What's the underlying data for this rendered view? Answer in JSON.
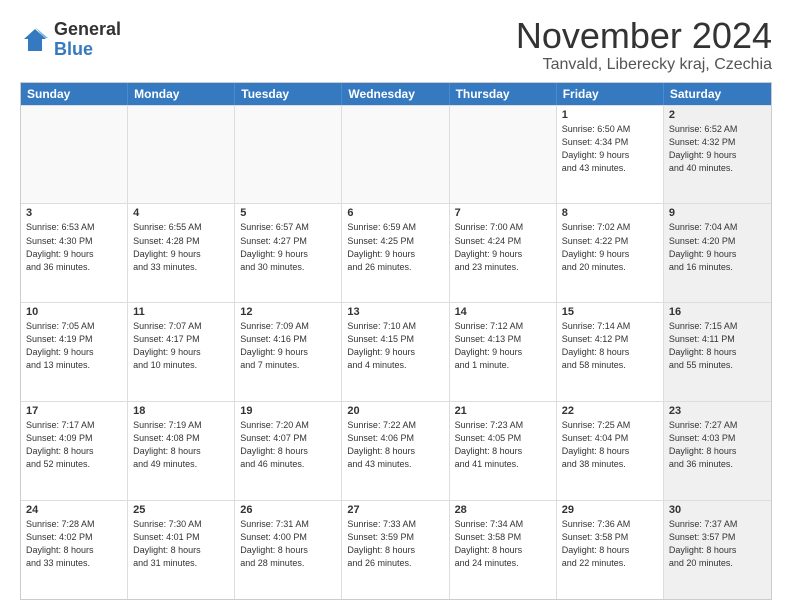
{
  "logo": {
    "general": "General",
    "blue": "Blue"
  },
  "title": "November 2024",
  "location": "Tanvald, Liberecky kraj, Czechia",
  "header_days": [
    "Sunday",
    "Monday",
    "Tuesday",
    "Wednesday",
    "Thursday",
    "Friday",
    "Saturday"
  ],
  "weeks": [
    [
      {
        "day": "",
        "info": "",
        "empty": true
      },
      {
        "day": "",
        "info": "",
        "empty": true
      },
      {
        "day": "",
        "info": "",
        "empty": true
      },
      {
        "day": "",
        "info": "",
        "empty": true
      },
      {
        "day": "",
        "info": "",
        "empty": true
      },
      {
        "day": "1",
        "info": "Sunrise: 6:50 AM\nSunset: 4:34 PM\nDaylight: 9 hours\nand 43 minutes.",
        "empty": false,
        "shaded": false
      },
      {
        "day": "2",
        "info": "Sunrise: 6:52 AM\nSunset: 4:32 PM\nDaylight: 9 hours\nand 40 minutes.",
        "empty": false,
        "shaded": true
      }
    ],
    [
      {
        "day": "3",
        "info": "Sunrise: 6:53 AM\nSunset: 4:30 PM\nDaylight: 9 hours\nand 36 minutes.",
        "empty": false,
        "shaded": false
      },
      {
        "day": "4",
        "info": "Sunrise: 6:55 AM\nSunset: 4:28 PM\nDaylight: 9 hours\nand 33 minutes.",
        "empty": false,
        "shaded": false
      },
      {
        "day": "5",
        "info": "Sunrise: 6:57 AM\nSunset: 4:27 PM\nDaylight: 9 hours\nand 30 minutes.",
        "empty": false,
        "shaded": false
      },
      {
        "day": "6",
        "info": "Sunrise: 6:59 AM\nSunset: 4:25 PM\nDaylight: 9 hours\nand 26 minutes.",
        "empty": false,
        "shaded": false
      },
      {
        "day": "7",
        "info": "Sunrise: 7:00 AM\nSunset: 4:24 PM\nDaylight: 9 hours\nand 23 minutes.",
        "empty": false,
        "shaded": false
      },
      {
        "day": "8",
        "info": "Sunrise: 7:02 AM\nSunset: 4:22 PM\nDaylight: 9 hours\nand 20 minutes.",
        "empty": false,
        "shaded": false
      },
      {
        "day": "9",
        "info": "Sunrise: 7:04 AM\nSunset: 4:20 PM\nDaylight: 9 hours\nand 16 minutes.",
        "empty": false,
        "shaded": true
      }
    ],
    [
      {
        "day": "10",
        "info": "Sunrise: 7:05 AM\nSunset: 4:19 PM\nDaylight: 9 hours\nand 13 minutes.",
        "empty": false,
        "shaded": false
      },
      {
        "day": "11",
        "info": "Sunrise: 7:07 AM\nSunset: 4:17 PM\nDaylight: 9 hours\nand 10 minutes.",
        "empty": false,
        "shaded": false
      },
      {
        "day": "12",
        "info": "Sunrise: 7:09 AM\nSunset: 4:16 PM\nDaylight: 9 hours\nand 7 minutes.",
        "empty": false,
        "shaded": false
      },
      {
        "day": "13",
        "info": "Sunrise: 7:10 AM\nSunset: 4:15 PM\nDaylight: 9 hours\nand 4 minutes.",
        "empty": false,
        "shaded": false
      },
      {
        "day": "14",
        "info": "Sunrise: 7:12 AM\nSunset: 4:13 PM\nDaylight: 9 hours\nand 1 minute.",
        "empty": false,
        "shaded": false
      },
      {
        "day": "15",
        "info": "Sunrise: 7:14 AM\nSunset: 4:12 PM\nDaylight: 8 hours\nand 58 minutes.",
        "empty": false,
        "shaded": false
      },
      {
        "day": "16",
        "info": "Sunrise: 7:15 AM\nSunset: 4:11 PM\nDaylight: 8 hours\nand 55 minutes.",
        "empty": false,
        "shaded": true
      }
    ],
    [
      {
        "day": "17",
        "info": "Sunrise: 7:17 AM\nSunset: 4:09 PM\nDaylight: 8 hours\nand 52 minutes.",
        "empty": false,
        "shaded": false
      },
      {
        "day": "18",
        "info": "Sunrise: 7:19 AM\nSunset: 4:08 PM\nDaylight: 8 hours\nand 49 minutes.",
        "empty": false,
        "shaded": false
      },
      {
        "day": "19",
        "info": "Sunrise: 7:20 AM\nSunset: 4:07 PM\nDaylight: 8 hours\nand 46 minutes.",
        "empty": false,
        "shaded": false
      },
      {
        "day": "20",
        "info": "Sunrise: 7:22 AM\nSunset: 4:06 PM\nDaylight: 8 hours\nand 43 minutes.",
        "empty": false,
        "shaded": false
      },
      {
        "day": "21",
        "info": "Sunrise: 7:23 AM\nSunset: 4:05 PM\nDaylight: 8 hours\nand 41 minutes.",
        "empty": false,
        "shaded": false
      },
      {
        "day": "22",
        "info": "Sunrise: 7:25 AM\nSunset: 4:04 PM\nDaylight: 8 hours\nand 38 minutes.",
        "empty": false,
        "shaded": false
      },
      {
        "day": "23",
        "info": "Sunrise: 7:27 AM\nSunset: 4:03 PM\nDaylight: 8 hours\nand 36 minutes.",
        "empty": false,
        "shaded": true
      }
    ],
    [
      {
        "day": "24",
        "info": "Sunrise: 7:28 AM\nSunset: 4:02 PM\nDaylight: 8 hours\nand 33 minutes.",
        "empty": false,
        "shaded": false
      },
      {
        "day": "25",
        "info": "Sunrise: 7:30 AM\nSunset: 4:01 PM\nDaylight: 8 hours\nand 31 minutes.",
        "empty": false,
        "shaded": false
      },
      {
        "day": "26",
        "info": "Sunrise: 7:31 AM\nSunset: 4:00 PM\nDaylight: 8 hours\nand 28 minutes.",
        "empty": false,
        "shaded": false
      },
      {
        "day": "27",
        "info": "Sunrise: 7:33 AM\nSunset: 3:59 PM\nDaylight: 8 hours\nand 26 minutes.",
        "empty": false,
        "shaded": false
      },
      {
        "day": "28",
        "info": "Sunrise: 7:34 AM\nSunset: 3:58 PM\nDaylight: 8 hours\nand 24 minutes.",
        "empty": false,
        "shaded": false
      },
      {
        "day": "29",
        "info": "Sunrise: 7:36 AM\nSunset: 3:58 PM\nDaylight: 8 hours\nand 22 minutes.",
        "empty": false,
        "shaded": false
      },
      {
        "day": "30",
        "info": "Sunrise: 7:37 AM\nSunset: 3:57 PM\nDaylight: 8 hours\nand 20 minutes.",
        "empty": false,
        "shaded": true
      }
    ]
  ]
}
